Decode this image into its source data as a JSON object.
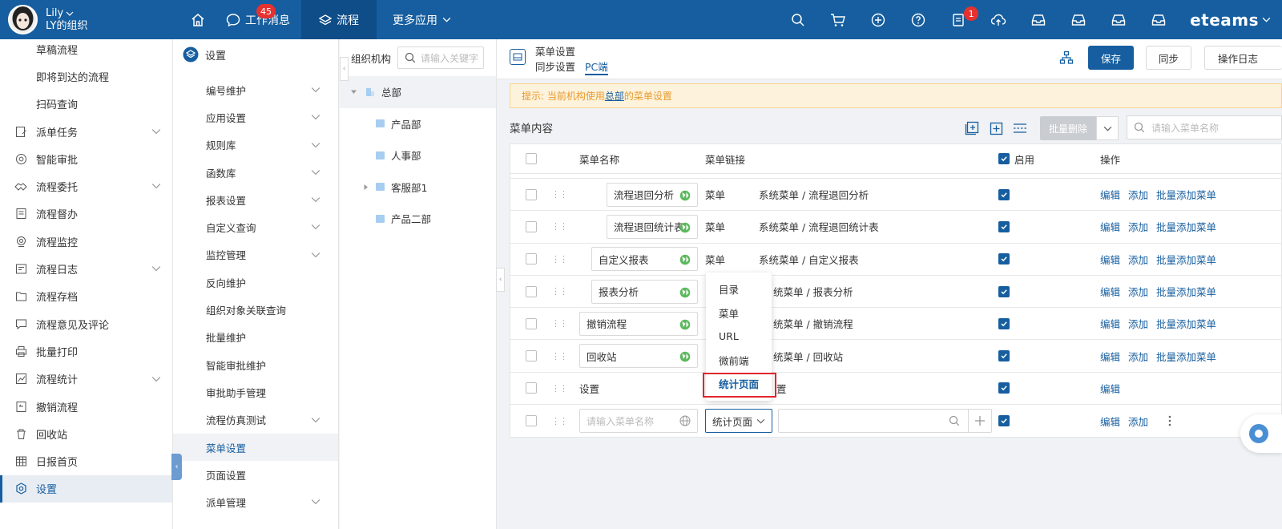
{
  "topbar": {
    "user_name": "Lily",
    "org_name": "LY的组织",
    "nav": [
      {
        "label": "",
        "icon": "home-icon"
      },
      {
        "label": "工作消息",
        "icon": "chat-icon",
        "badge": "45"
      },
      {
        "label": "流程",
        "icon": "layers-icon"
      },
      {
        "label": "更多应用",
        "icon": "chevron-down-icon"
      }
    ],
    "right_badge": "1",
    "brand": "eteams"
  },
  "sidebar": {
    "items": [
      {
        "label": "草稿流程"
      },
      {
        "label": "即将到达的流程"
      },
      {
        "label": "扫码查询"
      },
      {
        "label": "派单任务"
      },
      {
        "label": "智能审批"
      },
      {
        "label": "流程委托"
      },
      {
        "label": "流程督办"
      },
      {
        "label": "流程监控"
      },
      {
        "label": "流程日志"
      },
      {
        "label": "流程存档"
      },
      {
        "label": "流程意见及评论"
      },
      {
        "label": "批量打印"
      },
      {
        "label": "流程统计"
      },
      {
        "label": "撤销流程"
      },
      {
        "label": "回收站"
      },
      {
        "label": "日报首页"
      },
      {
        "label": "设置"
      }
    ]
  },
  "settings_panel": {
    "title": "设置",
    "items": [
      {
        "label": "编号维护"
      },
      {
        "label": "应用设置"
      },
      {
        "label": "规则库"
      },
      {
        "label": "函数库"
      },
      {
        "label": "报表设置"
      },
      {
        "label": "自定义查询"
      },
      {
        "label": "监控管理"
      },
      {
        "label": "反向维护"
      },
      {
        "label": "组织对象关联查询"
      },
      {
        "label": "批量维护"
      },
      {
        "label": "智能审批维护"
      },
      {
        "label": "审批助手管理"
      },
      {
        "label": "流程仿真测试"
      },
      {
        "label": "菜单设置"
      },
      {
        "label": "页面设置"
      },
      {
        "label": "派单管理"
      }
    ]
  },
  "org_panel": {
    "title": "组织机构",
    "search_placeholder": "请输入关键字",
    "tree": [
      {
        "label": "总部"
      },
      {
        "label": "产品部"
      },
      {
        "label": "人事部"
      },
      {
        "label": "客服部1"
      },
      {
        "label": "产品二部"
      }
    ]
  },
  "main": {
    "title": "菜单设置",
    "subtitle": "同步设置",
    "tab": "PC端",
    "save_label": "保存",
    "sync_label": "同步",
    "log_label": "操作日志",
    "notice_prefix": "提示: 当前机构使用",
    "notice_link": "总部",
    "notice_suffix": "的菜单设置",
    "section_title": "菜单内容",
    "bulk_delete_label": "批量删除",
    "search_placeholder": "请输入菜单名称",
    "columns": {
      "name": "菜单名称",
      "link": "菜单链接",
      "enabled": "启用",
      "ops": "操作"
    },
    "rows": [
      {
        "name": "流程退回分析",
        "type": "菜单",
        "path": "系统菜单 / 流程退回分析"
      },
      {
        "name": "流程退回统计表",
        "type": "菜单",
        "path": "系统菜单 / 流程退回统计表"
      },
      {
        "name": "自定义报表",
        "type": "菜单",
        "path": "系统菜单 / 自定义报表"
      },
      {
        "name": "报表分析",
        "type": "",
        "path": "统菜单 / 报表分析"
      },
      {
        "name": "撤销流程",
        "type": "",
        "path": "统菜单 / 撤销流程"
      },
      {
        "name": "回收站",
        "type": "",
        "path": "统菜单 / 回收站"
      },
      {
        "name": "设置",
        "type": "",
        "path": "置"
      }
    ],
    "ops": {
      "edit": "编辑",
      "add": "添加",
      "bulk_add": "批量添加菜单"
    },
    "new_row": {
      "name_placeholder": "请输入菜单名称",
      "type_value": "统计页面"
    },
    "dropdown_options": [
      "目录",
      "菜单",
      "URL",
      "微前端",
      "统计页面"
    ]
  },
  "colors": {
    "primary": "#165e9f",
    "notice_bg": "#fdf2db",
    "highlight_red": "#e0262c"
  }
}
